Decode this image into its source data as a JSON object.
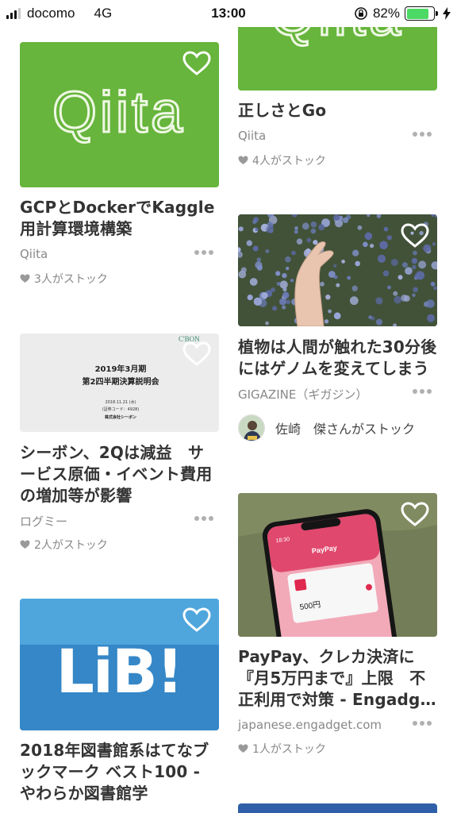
{
  "status_bar": {
    "carrier": "docomo",
    "network": "4G",
    "time": "13:00",
    "battery": "82%",
    "battery_level": 0.82
  },
  "left_column": [
    {
      "thumb_text": "Qiita",
      "title": "GCPとDockerでKaggle用計算環境構築",
      "source": "Qiita",
      "stock": "3人がストック"
    },
    {
      "thumb_lines": [
        "2019年3月期",
        "第2四半期決算説明会",
        "2018.11.21 (水)",
        "(証券コード：4928)",
        "株式会社シーボン"
      ],
      "thumb_brand": "C'BON",
      "title": "シーボン、2Qは減益　サービス原価・イベント費用の増加等が影響",
      "source": "ログミー",
      "stock": "2人がストック"
    },
    {
      "thumb_text": "LiB!",
      "title": "2018年図書館系はてなブックマーク ベスト100 - やわらか図書館学"
    }
  ],
  "right_column": [
    {
      "thumb_text": "Qiita",
      "title": "正しさとGo",
      "source": "Qiita",
      "stock": "4人がストック"
    },
    {
      "title": "植物は人間が触れた30分後にはゲノムを変えてしまう",
      "source": "GIGAZINE（ギガジン）",
      "user_stock": "佐崎　傑さんがストック"
    },
    {
      "thumb_text": "PayPay",
      "thumb_amount": "500円",
      "thumb_time": "18:30",
      "title": "PayPay、クレカ決済に『月5万円まで』上限　不正利用で対策 - Engadg…",
      "source": "japanese.engadget.com",
      "stock": "1人がストック"
    }
  ],
  "colors": {
    "qiita_green": "#67b53c",
    "lib_blue": "#3a93d0",
    "text": "#333333",
    "muted": "#888888"
  }
}
